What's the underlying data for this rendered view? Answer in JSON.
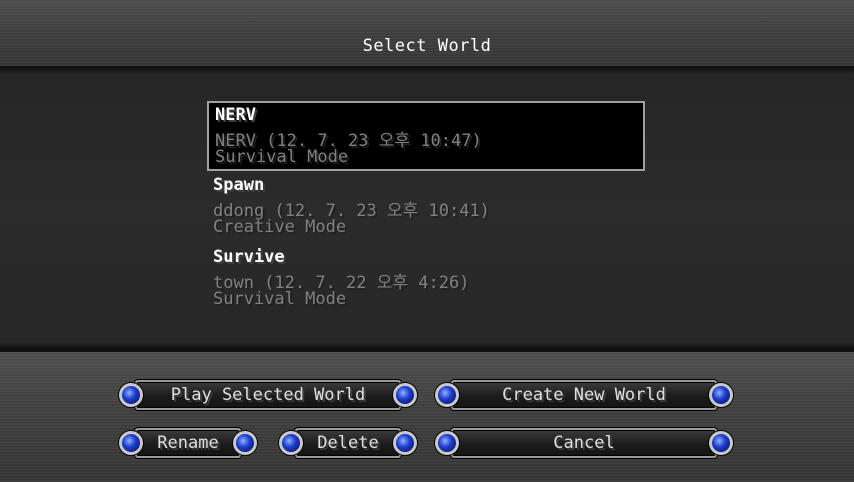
{
  "screen": {
    "title": "Select World"
  },
  "worlds": [
    {
      "name": "NERV",
      "meta": "NERV (12. 7. 23 오후 10:47)",
      "mode": "Survival Mode",
      "selected": true
    },
    {
      "name": "Spawn",
      "meta": "ddong (12. 7. 23 오후 10:41)",
      "mode": "Creative Mode",
      "selected": false
    },
    {
      "name": "Survive",
      "meta": "town (12. 7. 22 오후 4:26)",
      "mode": "Survival Mode",
      "selected": false
    }
  ],
  "buttons": {
    "play": "Play Selected World",
    "create": "Create New World",
    "rename": "Rename",
    "delete": "Delete",
    "cancel": "Cancel"
  },
  "icons": {
    "button_gem": "blue-gem-icon"
  },
  "colors": {
    "title_text": "#ffffff",
    "meta_text": "#808080",
    "gem": "#1f3fd0"
  }
}
